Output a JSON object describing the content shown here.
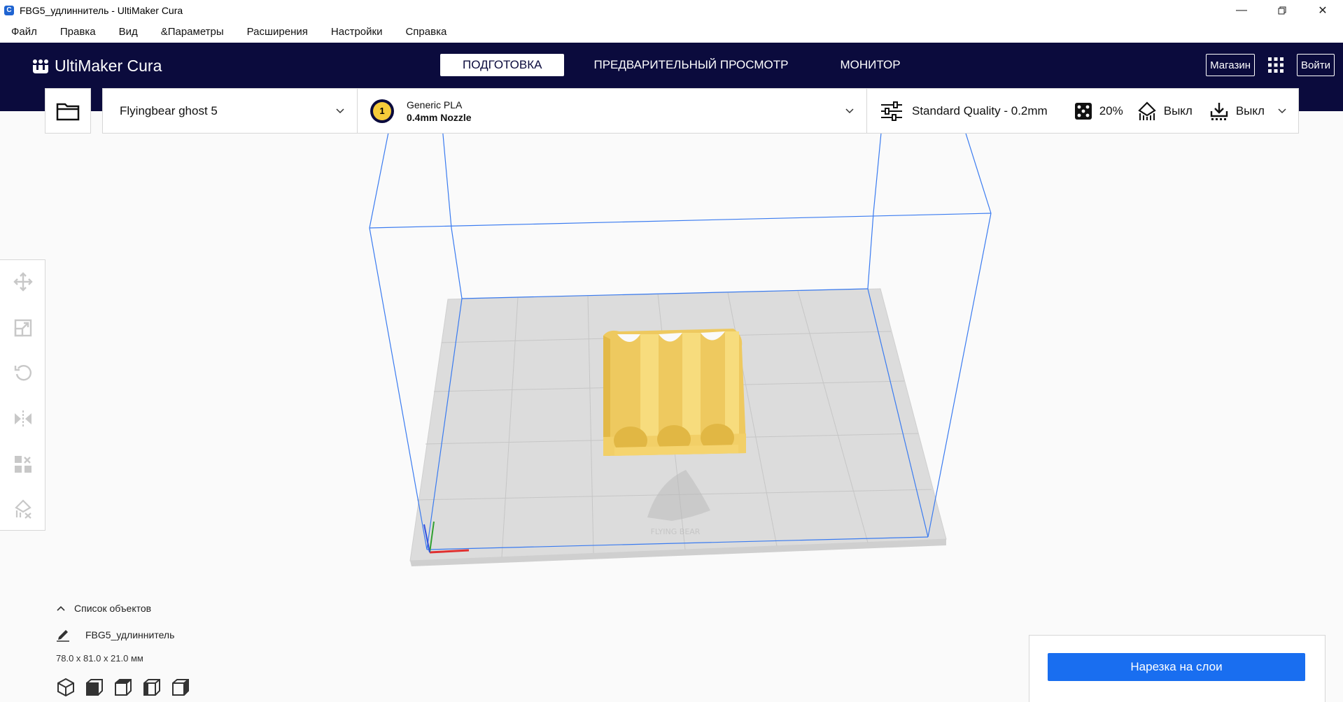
{
  "window": {
    "title": "FBG5_удлиннитель - UltiMaker Cura",
    "app_icon_letter": "C"
  },
  "menu": [
    "Файл",
    "Правка",
    "Вид",
    "&Параметры",
    "Расширения",
    "Настройки",
    "Справка"
  ],
  "header": {
    "logo": "UltiMaker Cura",
    "tabs": [
      {
        "label": "ПОДГОТОВКА",
        "active": true
      },
      {
        "label": "ПРЕДВАРИТЕЛЬНЫЙ ПРОСМОТР",
        "active": false
      },
      {
        "label": "МОНИТОР",
        "active": false
      }
    ],
    "marketplace_label": "Магазин",
    "signin_label": "Войти"
  },
  "printer": {
    "name": "Flyingbear ghost 5"
  },
  "material": {
    "extruder_number": "1",
    "name": "Generic PLA",
    "nozzle": "0.4mm Nozzle"
  },
  "print_settings": {
    "profile": "Standard Quality - 0.2mm",
    "infill": "20%",
    "support": "Выкл",
    "adhesion": "Выкл"
  },
  "object_list": {
    "header": "Список объектов",
    "object_name": "FBG5_удлиннитель",
    "dimensions": "78.0 x 81.0 x 21.0 мм"
  },
  "slice_button": "Нарезка на слои",
  "colors": {
    "header_bg": "#0b0b3d",
    "accent_blue": "#196ef0",
    "model_yellow": "#f5d56c",
    "bed_grey": "#dcdcdc",
    "volume_outline": "#3a7bf0"
  },
  "icons": {
    "left_tools": [
      "move-icon",
      "scale-icon",
      "rotate-icon",
      "mirror-icon",
      "per-model-settings-icon",
      "support-blocker-icon"
    ],
    "view_buttons": [
      "3d-view-icon",
      "front-view-icon",
      "top-view-icon",
      "left-view-icon",
      "right-view-icon"
    ]
  }
}
